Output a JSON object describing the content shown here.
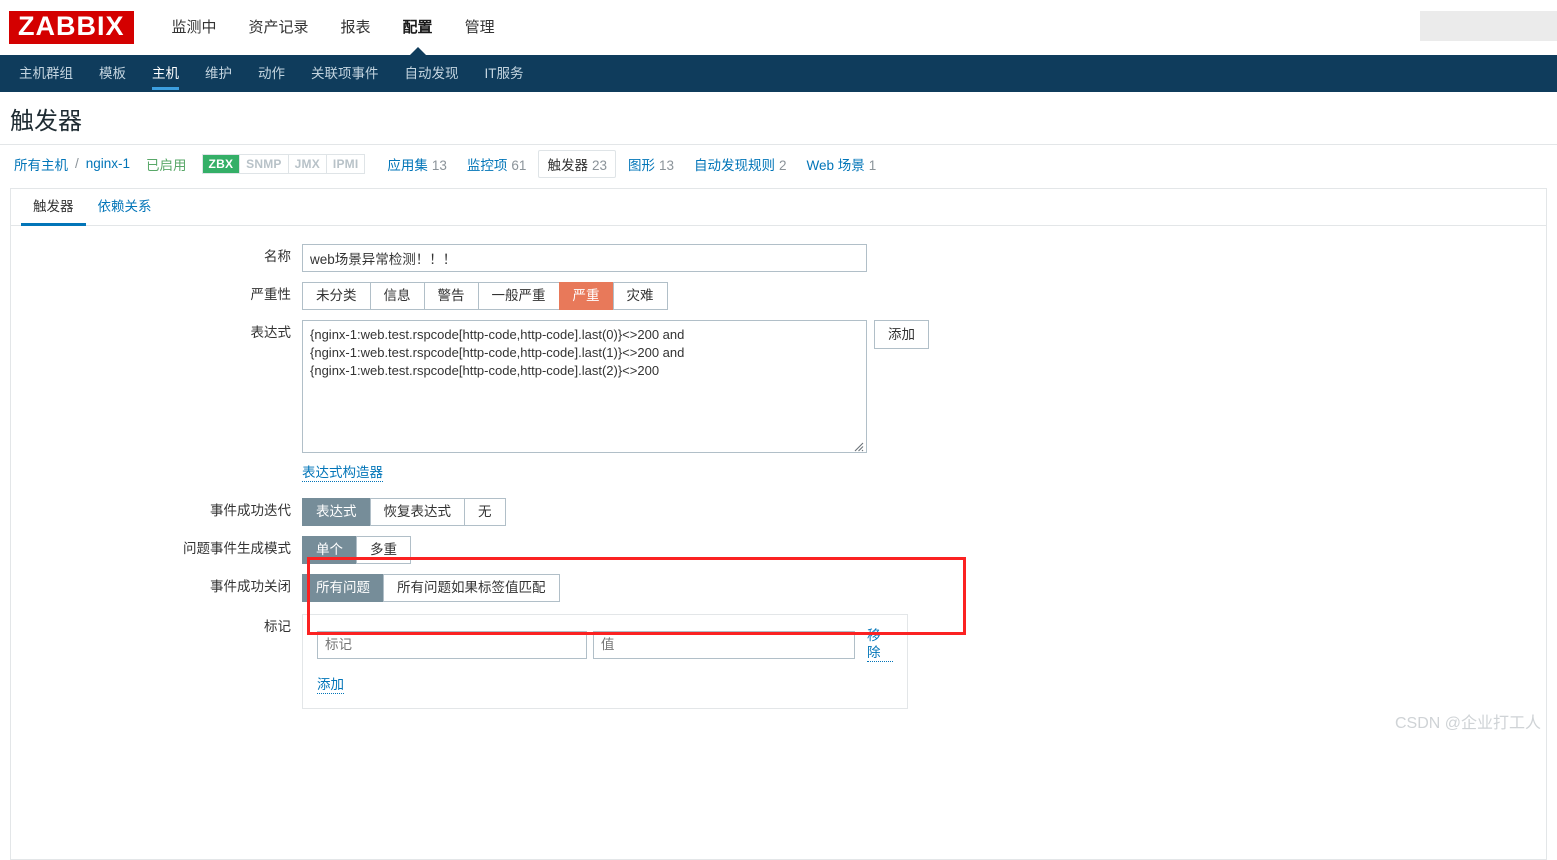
{
  "header": {
    "logo_text": "ZABBIX",
    "menu": [
      {
        "label": "监测中",
        "selected": false
      },
      {
        "label": "资产记录",
        "selected": false
      },
      {
        "label": "报表",
        "selected": false
      },
      {
        "label": "配置",
        "selected": true
      },
      {
        "label": "管理",
        "selected": false
      }
    ],
    "search_placeholder": ""
  },
  "subnav": {
    "items": [
      {
        "label": "主机群组",
        "selected": false
      },
      {
        "label": "模板",
        "selected": false
      },
      {
        "label": "主机",
        "selected": true
      },
      {
        "label": "维护",
        "selected": false
      },
      {
        "label": "动作",
        "selected": false
      },
      {
        "label": "关联项事件",
        "selected": false
      },
      {
        "label": "自动发现",
        "selected": false
      },
      {
        "label": "IT服务",
        "selected": false
      }
    ]
  },
  "page": {
    "title": "触发器"
  },
  "breadcrumb": {
    "all_hosts": "所有主机",
    "separator": "/",
    "host": "nginx-1",
    "status": "已启用",
    "interfaces": [
      {
        "label": "ZBX",
        "active": true
      },
      {
        "label": "SNMP",
        "active": false
      },
      {
        "label": "JMX",
        "active": false
      },
      {
        "label": "IPMI",
        "active": false
      }
    ],
    "links": [
      {
        "label": "应用集",
        "count": "13",
        "current": false
      },
      {
        "label": "监控项",
        "count": "61",
        "current": false
      },
      {
        "label": "触发器",
        "count": "23",
        "current": true
      },
      {
        "label": "图形",
        "count": "13",
        "current": false
      },
      {
        "label": "自动发现规则",
        "count": "2",
        "current": false
      },
      {
        "label": "Web 场景",
        "count": "1",
        "current": false
      }
    ]
  },
  "tabs": [
    {
      "label": "触发器",
      "active": true
    },
    {
      "label": "依赖关系",
      "active": false
    }
  ],
  "form": {
    "name": {
      "label": "名称",
      "value": "web场景异常检测！！！",
      "placeholder": ""
    },
    "severity": {
      "label": "严重性",
      "options": [
        {
          "label": "未分类",
          "state": "normal"
        },
        {
          "label": "信息",
          "state": "normal"
        },
        {
          "label": "警告",
          "state": "normal"
        },
        {
          "label": "一般严重",
          "state": "normal"
        },
        {
          "label": "严重",
          "state": "selected-orange"
        },
        {
          "label": "灾难",
          "state": "normal"
        }
      ]
    },
    "expression": {
      "label": "表达式",
      "value": "{nginx-1:web.test.rspcode[http-code,http-code].last(0)}<>200 and\n{nginx-1:web.test.rspcode[http-code,http-code].last(1)}<>200 and\n{nginx-1:web.test.rspcode[http-code,http-code].last(2)}<>200",
      "add_button": "添加",
      "constructor_link": "表达式构造器",
      "highlight_color": "#fb2222"
    },
    "event_success_iteration": {
      "label": "事件成功迭代",
      "options": [
        {
          "label": "表达式",
          "state": "selected-gray"
        },
        {
          "label": "恢复表达式",
          "state": "normal"
        },
        {
          "label": "无",
          "state": "normal"
        }
      ]
    },
    "problem_event_mode": {
      "label": "问题事件生成模式",
      "options": [
        {
          "label": "单个",
          "state": "selected-gray"
        },
        {
          "label": "多重",
          "state": "normal"
        }
      ]
    },
    "event_success_close": {
      "label": "事件成功关闭",
      "options": [
        {
          "label": "所有问题",
          "state": "selected-gray"
        },
        {
          "label": "所有问题如果标签值匹配",
          "state": "normal"
        }
      ]
    },
    "tags": {
      "label": "标记",
      "tag_placeholder": "标记",
      "tag_value": "",
      "value_placeholder": "值",
      "value_value": "",
      "remove_link": "移除",
      "add_link": "添加"
    }
  },
  "watermark": "CSDN @企业打工人",
  "colors": {
    "brand_red": "#d40000",
    "nav_blue": "#0f3c5c",
    "link_blue": "#0275b8",
    "accent_blue": "#3c9fe0",
    "severity_high": "#e8795a",
    "selected_gray": "#768d99",
    "status_green": "#59a869",
    "zbx_green": "#34af67",
    "annotation_red": "#fb2222"
  }
}
